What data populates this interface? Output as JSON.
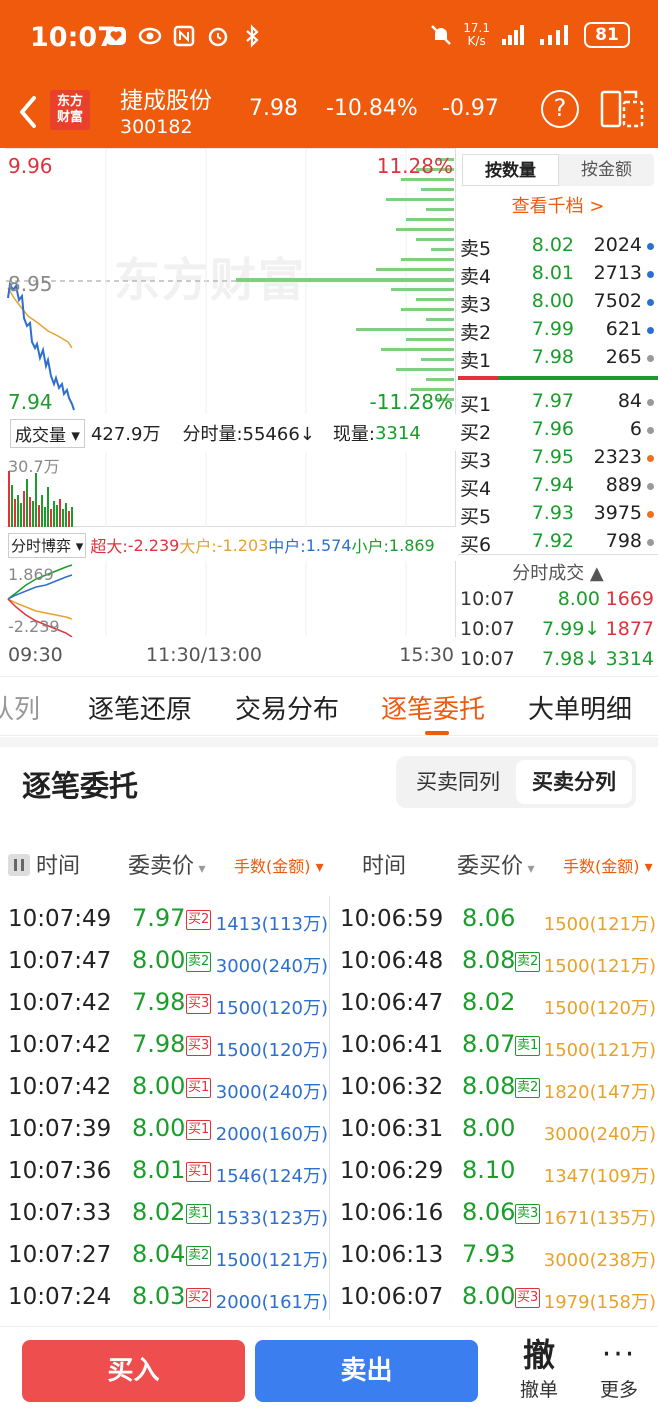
{
  "status": {
    "time": "10:07",
    "speed_value": "17.1",
    "speed_unit": "K/s",
    "battery": "81",
    "icons": [
      "heart-icon",
      "eye-icon",
      "nfc-icon",
      "alarm-icon",
      "bluetooth-icon",
      "mute-icon",
      "signal-icon",
      "signal-icon-2",
      "battery-icon"
    ]
  },
  "header": {
    "logo_line1": "东方",
    "logo_line2": "财富",
    "stock_name": "捷成股份",
    "stock_code": "300182",
    "price": "7.98",
    "change_pct": "-10.84%",
    "change": "-0.97",
    "help": "?"
  },
  "chart": {
    "price_high": "9.96",
    "price_mid": "8.95",
    "price_low": "7.94",
    "pct_high": "11.28%",
    "pct_low": "-11.28%",
    "watermark": "东方财富",
    "volume_selector": "成交量",
    "volume_total": "427.9万",
    "tick_volume": "分时量:55466↓",
    "current_volume_label": "现量:",
    "current_volume": "3314",
    "volume_max": "30.7万",
    "flow_selector": "分时博弈",
    "flow_super_label": "超大:",
    "flow_super": "-2.239",
    "flow_large_label": "大户:",
    "flow_large": "-1.203",
    "flow_medium_label": "中户:",
    "flow_medium": "1.574",
    "flow_small_label": "小户:",
    "flow_small": "1.869",
    "flow_max": "1.869",
    "flow_min": "-2.239",
    "time_start": "09:30",
    "time_mid": "11:30/13:00",
    "time_end": "15:30"
  },
  "book": {
    "mode_qty": "按数量",
    "mode_amt": "按金额",
    "qiandang": "查看千档 >",
    "asks": [
      {
        "name": "卖5",
        "price": "8.02",
        "vol": "2024",
        "dot": "#2d6fd0"
      },
      {
        "name": "卖4",
        "price": "8.01",
        "vol": "2713",
        "dot": "#2d6fd0"
      },
      {
        "name": "卖3",
        "price": "8.00",
        "vol": "7502",
        "dot": "#2d6fd0"
      },
      {
        "name": "卖2",
        "price": "7.99",
        "vol": "621",
        "dot": "#2d6fd0"
      },
      {
        "name": "卖1",
        "price": "7.98",
        "vol": "265",
        "dot": "#999999"
      }
    ],
    "bids": [
      {
        "name": "买1",
        "price": "7.97",
        "vol": "84",
        "dot": "#999999"
      },
      {
        "name": "买2",
        "price": "7.96",
        "vol": "6",
        "dot": "#999999"
      },
      {
        "name": "买3",
        "price": "7.95",
        "vol": "2323",
        "dot": "#f07020"
      },
      {
        "name": "买4",
        "price": "7.94",
        "vol": "889",
        "dot": "#999999"
      },
      {
        "name": "买5",
        "price": "7.93",
        "vol": "3975",
        "dot": "#f07020"
      },
      {
        "name": "买6",
        "price": "7.92",
        "vol": "798",
        "dot": "#999999"
      }
    ],
    "ticks_title": "分时成交 ▲",
    "ticks": [
      {
        "time": "10:07",
        "price": "8.00",
        "vol": "1669",
        "price_color": "#1a9d2a",
        "vol_color": "#e0323b"
      },
      {
        "time": "10:07",
        "price": "7.99↓",
        "vol": "1877",
        "price_color": "#1a9d2a",
        "vol_color": "#e0323b"
      },
      {
        "time": "10:07",
        "price": "7.98↓",
        "vol": "3314",
        "price_color": "#1a9d2a",
        "vol_color": "#1a9d2a"
      }
    ]
  },
  "tabs": [
    {
      "label": "队列",
      "active": false
    },
    {
      "label": "逐笔还原",
      "active": false
    },
    {
      "label": "交易分布",
      "active": false
    },
    {
      "label": "逐笔委托",
      "active": true
    },
    {
      "label": "大单明细",
      "active": false
    }
  ],
  "section": {
    "title": "逐笔委托",
    "seg_same": "买卖同列",
    "seg_split": "买卖分列"
  },
  "columns": {
    "time_left": "时间",
    "sell_price": "委卖价",
    "qty_left": "手数(金额)",
    "time_right": "时间",
    "buy_price": "委买价",
    "qty_right": "手数(金额)"
  },
  "sell_rows": [
    {
      "time": "10:07:49",
      "price": "7.97",
      "tag": "买2",
      "tag_type": "buy",
      "qty": "1413(113万)"
    },
    {
      "time": "10:07:47",
      "price": "8.00",
      "tag": "卖2",
      "tag_type": "sell",
      "qty": "3000(240万)"
    },
    {
      "time": "10:07:42",
      "price": "7.98",
      "tag": "买3",
      "tag_type": "buy",
      "qty": "1500(120万)"
    },
    {
      "time": "10:07:42",
      "price": "7.98",
      "tag": "买3",
      "tag_type": "buy",
      "qty": "1500(120万)"
    },
    {
      "time": "10:07:42",
      "price": "8.00",
      "tag": "买1",
      "tag_type": "buy",
      "qty": "3000(240万)"
    },
    {
      "time": "10:07:39",
      "price": "8.00",
      "tag": "买1",
      "tag_type": "buy",
      "qty": "2000(160万)"
    },
    {
      "time": "10:07:36",
      "price": "8.01",
      "tag": "买1",
      "tag_type": "buy",
      "qty": "1546(124万)"
    },
    {
      "time": "10:07:33",
      "price": "8.02",
      "tag": "卖1",
      "tag_type": "sell",
      "qty": "1533(123万)"
    },
    {
      "time": "10:07:27",
      "price": "8.04",
      "tag": "卖2",
      "tag_type": "sell",
      "qty": "1500(121万)"
    },
    {
      "time": "10:07:24",
      "price": "8.03",
      "tag": "买2",
      "tag_type": "buy",
      "qty": "2000(161万)"
    }
  ],
  "buy_rows": [
    {
      "time": "10:06:59",
      "price": "8.06",
      "tag": "",
      "tag_type": "",
      "qty": "1500(121万)"
    },
    {
      "time": "10:06:48",
      "price": "8.08",
      "tag": "卖2",
      "tag_type": "sell",
      "qty": "1500(121万)"
    },
    {
      "time": "10:06:47",
      "price": "8.02",
      "tag": "",
      "tag_type": "",
      "qty": "1500(120万)"
    },
    {
      "time": "10:06:41",
      "price": "8.07",
      "tag": "卖1",
      "tag_type": "sell",
      "qty": "1500(121万)"
    },
    {
      "time": "10:06:32",
      "price": "8.08",
      "tag": "卖2",
      "tag_type": "sell",
      "qty": "1820(147万)"
    },
    {
      "time": "10:06:31",
      "price": "8.00",
      "tag": "",
      "tag_type": "",
      "qty": "3000(240万)"
    },
    {
      "time": "10:06:29",
      "price": "8.10",
      "tag": "",
      "tag_type": "",
      "qty": "1347(109万)"
    },
    {
      "time": "10:06:16",
      "price": "8.06",
      "tag": "卖3",
      "tag_type": "sell",
      "qty": "1671(135万)"
    },
    {
      "time": "10:06:13",
      "price": "7.93",
      "tag": "",
      "tag_type": "",
      "qty": "3000(238万)"
    },
    {
      "time": "10:06:07",
      "price": "8.00",
      "tag": "买3",
      "tag_type": "buy",
      "qty": "1979(158万)"
    }
  ],
  "bottom": {
    "buy": "买入",
    "sell": "卖出",
    "cancel_big": "撤",
    "cancel_small": "撤单",
    "more_dots": "···",
    "more_small": "更多"
  },
  "colors": {
    "brand": "#ef5a0c",
    "up": "#e0323b",
    "down": "#1a9d2a",
    "buy_button": "#ee4e4e",
    "sell_button": "#3a7ef0"
  }
}
